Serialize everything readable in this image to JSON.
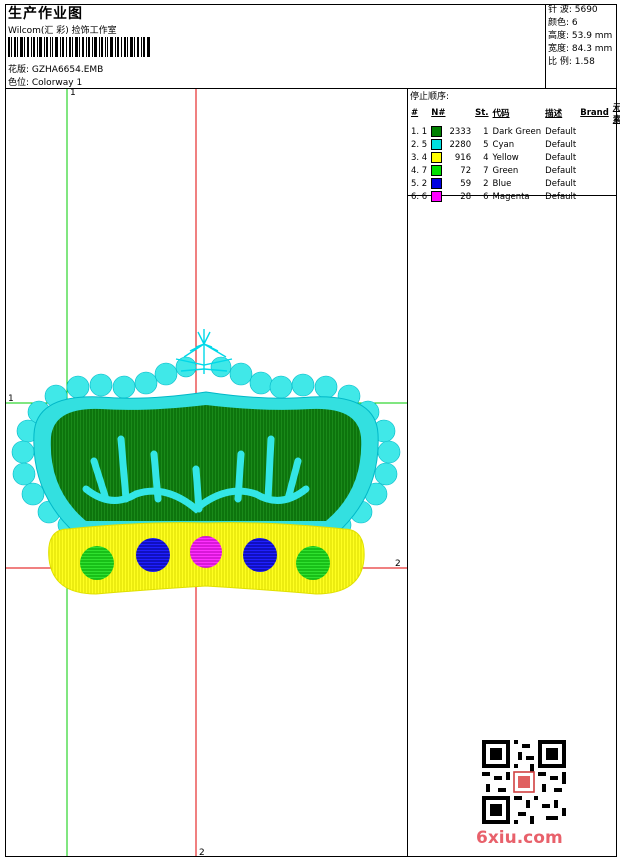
{
  "header": {
    "title": "生产作业图",
    "company": "Wilcom(汇 彩) 捡饰工作室",
    "pattern": "花版: GZHA6654.EMB",
    "colorway": "色位: Colorway 1"
  },
  "stats": {
    "stitches": "针 波: 5690",
    "colors": "颜色: 6",
    "height": "高度: 53.9 mm",
    "width": "宽度: 84.3 mm",
    "ratio": "比 例: 1.58"
  },
  "stop_sequence": {
    "title": "停止顺序:",
    "headers": [
      "#",
      "N#",
      "St.",
      "代码",
      "描述",
      "Brand",
      "元素"
    ],
    "rows": [
      {
        "idx": "1. 1",
        "color": "#008000",
        "st": "2333",
        "code": "1",
        "desc": "Dark Green",
        "brand": "Default"
      },
      {
        "idx": "2. 5",
        "color": "#00e0e0",
        "st": "2280",
        "code": "5",
        "desc": "Cyan",
        "brand": "Default"
      },
      {
        "idx": "3. 4",
        "color": "#ffff00",
        "st": "916",
        "code": "4",
        "desc": "Yellow",
        "brand": "Default"
      },
      {
        "idx": "4. 7",
        "color": "#00e000",
        "st": "72",
        "code": "7",
        "desc": "Green",
        "brand": "Default"
      },
      {
        "idx": "5. 2",
        "color": "#0000e0",
        "st": "59",
        "code": "2",
        "desc": "Blue",
        "brand": "Default"
      },
      {
        "idx": "6. 6",
        "color": "#ff00ff",
        "st": "28",
        "code": "6",
        "desc": "Magenta",
        "brand": "Default"
      }
    ]
  },
  "guides": {
    "v1": "1",
    "h1": "1",
    "h2": "2",
    "v2": "2"
  },
  "watermark": "6xiu.com",
  "colors": {
    "green_guide": "#00cc00",
    "red_guide": "#e00000",
    "cyan": "#00e0e0",
    "dark_green": "#008000",
    "yellow": "#ffff00"
  }
}
